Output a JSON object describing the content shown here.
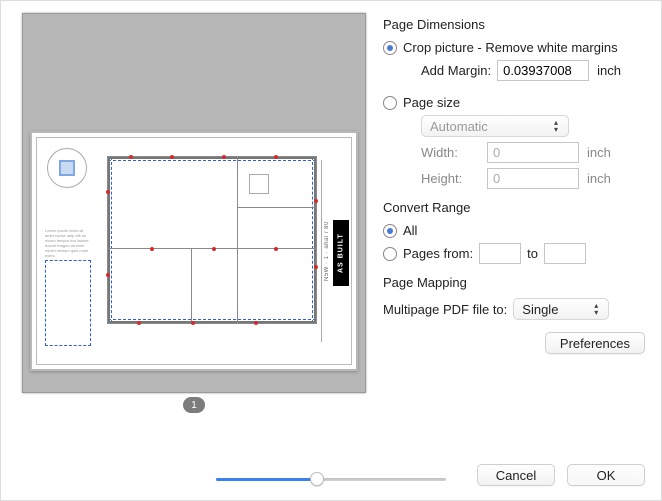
{
  "preview": {
    "page_number": "1",
    "stamp_label": "AS BUILT",
    "side_label": "N5W · 1 · ahal / 80"
  },
  "page_dimensions": {
    "title": "Page Dimensions",
    "crop": {
      "label": "Crop picture - Remove white margins",
      "checked": true,
      "add_margin_label": "Add Margin:",
      "add_margin_value": "0.03937008",
      "add_margin_unit": "inch"
    },
    "page_size": {
      "label": "Page size",
      "checked": false,
      "preset_value": "Automatic",
      "width_label": "Width:",
      "width_value": "0",
      "width_unit": "inch",
      "height_label": "Height:",
      "height_value": "0",
      "height_unit": "inch"
    }
  },
  "convert_range": {
    "title": "Convert Range",
    "all": {
      "label": "All",
      "checked": true
    },
    "pages": {
      "label": "Pages from:",
      "checked": false,
      "from": "",
      "to_label": "to",
      "to": ""
    }
  },
  "page_mapping": {
    "title": "Page Mapping",
    "label": "Multipage PDF file to:",
    "value": "Single"
  },
  "buttons": {
    "preferences": "Preferences",
    "cancel": "Cancel",
    "ok": "OK"
  }
}
